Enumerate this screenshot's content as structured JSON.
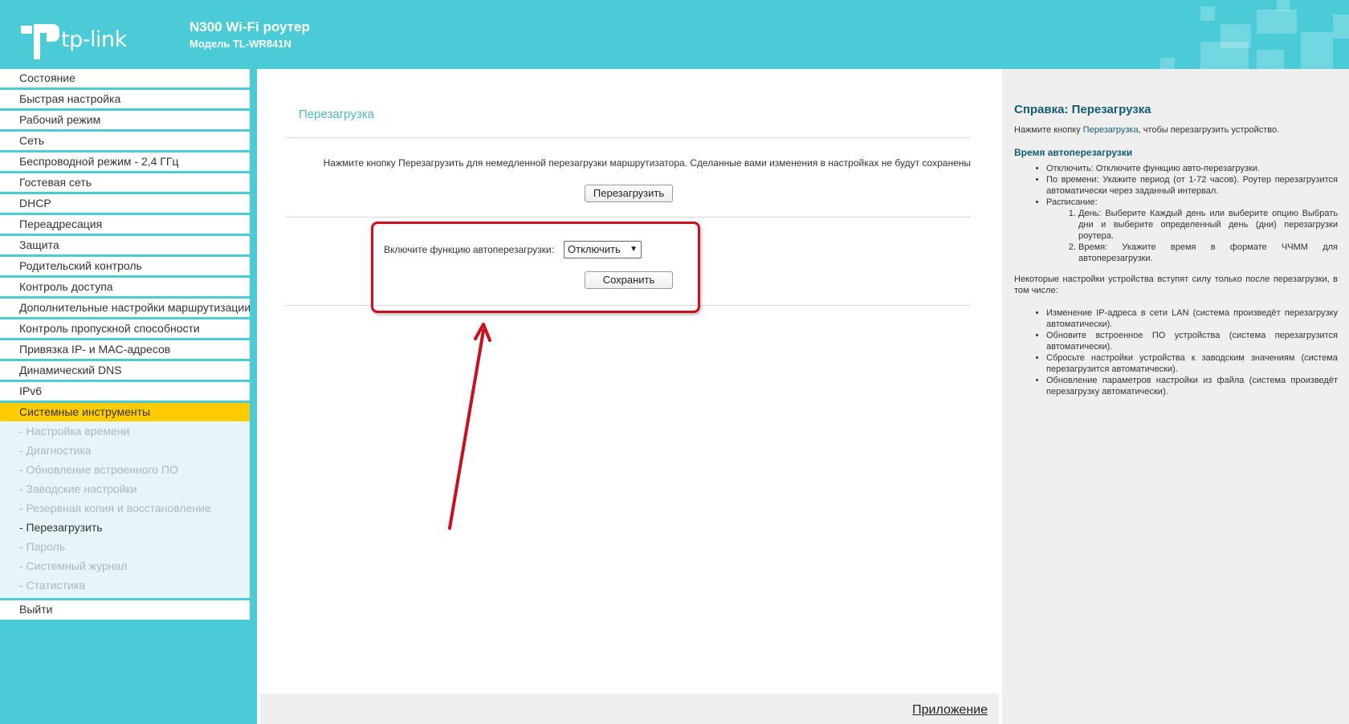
{
  "header": {
    "logo_text": "tp-link",
    "title": "N300 Wi-Fi роутер",
    "model": "Модель TL-WR841N"
  },
  "sidebar": {
    "items": [
      {
        "label": "Состояние"
      },
      {
        "label": "Быстрая настройка"
      },
      {
        "label": "Рабочий режим"
      },
      {
        "label": "Сеть"
      },
      {
        "label": "Беспроводной режим - 2,4 ГГц"
      },
      {
        "label": "Гостевая сеть"
      },
      {
        "label": "DHCP"
      },
      {
        "label": "Переадресация"
      },
      {
        "label": "Защита"
      },
      {
        "label": "Родительский контроль"
      },
      {
        "label": "Контроль доступа"
      },
      {
        "label": "Дополнительные настройки маршрутизации"
      },
      {
        "label": "Контроль пропускной способности"
      },
      {
        "label": "Привязка IP- и MAC-адресов"
      },
      {
        "label": "Динамический DNS"
      },
      {
        "label": "IPv6"
      },
      {
        "label": "Системные инструменты"
      }
    ],
    "sub_items": [
      {
        "label": "- Настройка времени"
      },
      {
        "label": "- Диагностика"
      },
      {
        "label": "- Обновление встроенного ПО"
      },
      {
        "label": "- Заводские настройки"
      },
      {
        "label": "- Резервная копия и восстановление"
      },
      {
        "label": "- Перезагрузить"
      },
      {
        "label": "- Пароль"
      },
      {
        "label": "- Системный журнал"
      },
      {
        "label": "- Статистика"
      }
    ],
    "logout": "Выйти"
  },
  "main": {
    "title": "Перезагрузка",
    "info": "Нажмите кнопку Перезагрузить для немедленной перезагрузки маршрутизатора. Сделанные вами изменения в настройках не будут сохранены",
    "reboot_button": "Перезагрузить",
    "auto_label": "Включите функцию автоперезагрузки:",
    "auto_value": "Отключить",
    "save_button": "Сохранить",
    "footer_link": "Приложение"
  },
  "help": {
    "title": "Справка: Перезагрузка",
    "intro_before": "Нажмите кнопку ",
    "intro_link": "Перезагрузка",
    "intro_after": ", чтобы перезагрузить устройство.",
    "subtitle": "Время автоперезагрузки",
    "items": [
      "Отключить: Отключите функцию авто-перезагрузки.",
      "По времени: Укажите период (от 1-72 часов). Роутер перезагрузится автоматически через заданный интервал.",
      "Расписание:"
    ],
    "schedule": [
      "День: Выберите Каждый день или выберите опцию Выбрать дни и выберите определенный день (дни) перезагрузки роутера.",
      "Время: Укажите время в формате ЧЧММ для автоперезагрузки."
    ],
    "note": "Некоторые настройки устройства вступят силу только после перезагрузки, в том числе:",
    "note_items": [
      "Изменение IP-адреса в сети LAN (система произведёт перезагрузку автоматически).",
      "Обновите встроенное ПО устройства (система перезагрузится автоматически).",
      "Сбросьте настройки устройства к заводским значениям (система перезагрузится автоматически).",
      "Обновление параметров настройки из файла (система произведёт перезагрузку автоматически)."
    ]
  },
  "colors": {
    "header_bg": "#4acbd6",
    "active_menu": "#ffcc00",
    "annotation": "#c8101e"
  }
}
